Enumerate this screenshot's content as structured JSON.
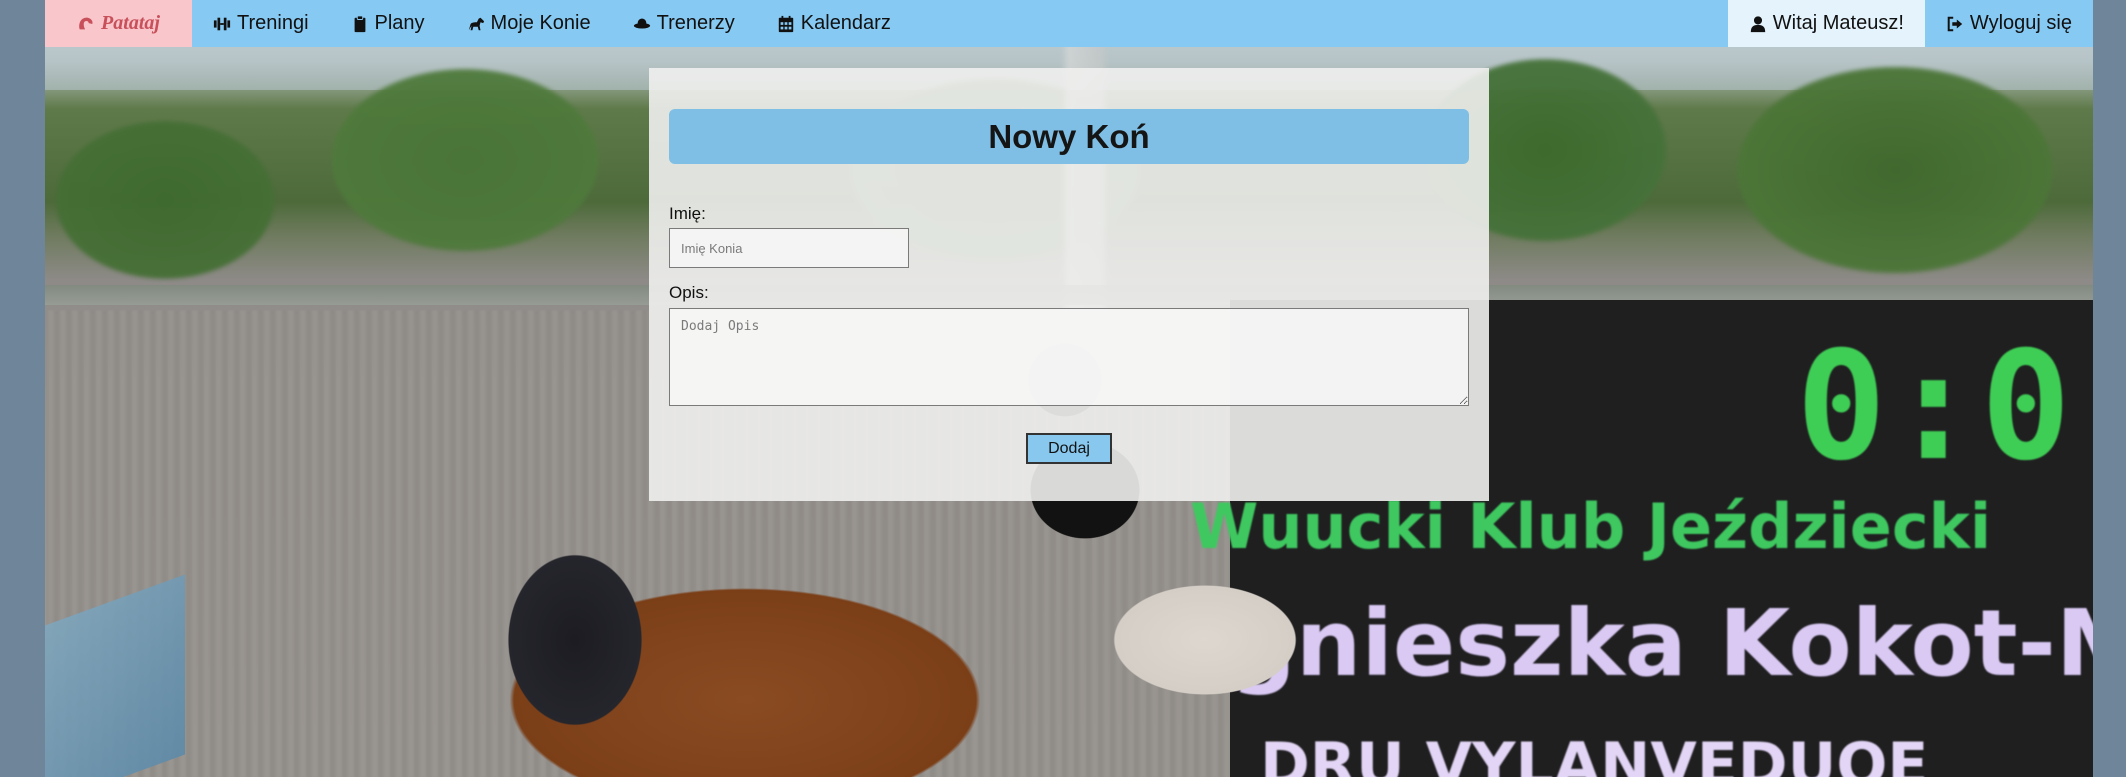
{
  "navbar": {
    "brand": "Patataj",
    "items": [
      {
        "label": "Treningi",
        "icon": "dumbbell-icon"
      },
      {
        "label": "Plany",
        "icon": "clipboard-icon"
      },
      {
        "label": "Moje Konie",
        "icon": "horse-icon"
      },
      {
        "label": "Trenerzy",
        "icon": "hat-icon"
      },
      {
        "label": "Kalendarz",
        "icon": "calendar-icon"
      }
    ],
    "welcome": "Witaj Mateusz!",
    "logout": "Wyloguj się",
    "colors": {
      "bar": "#86c9f3",
      "brand_bg": "#f8c6cb",
      "brand_text": "#c8505a"
    }
  },
  "form": {
    "title": "Nowy Koń",
    "name_label": "Imię:",
    "name_placeholder": "Imię Konia",
    "name_value": "",
    "desc_label": "Opis:",
    "desc_placeholder": "Dodaj Opis",
    "desc_value": "",
    "submit_label": "Dodaj"
  },
  "background": {
    "scoreboard": {
      "score": "0:0",
      "line1": "Wuucki Klub Jeździecki",
      "line2": "gnieszka Kokot-Marcis",
      "line3": "DRU VYLANVEDUOE"
    }
  }
}
